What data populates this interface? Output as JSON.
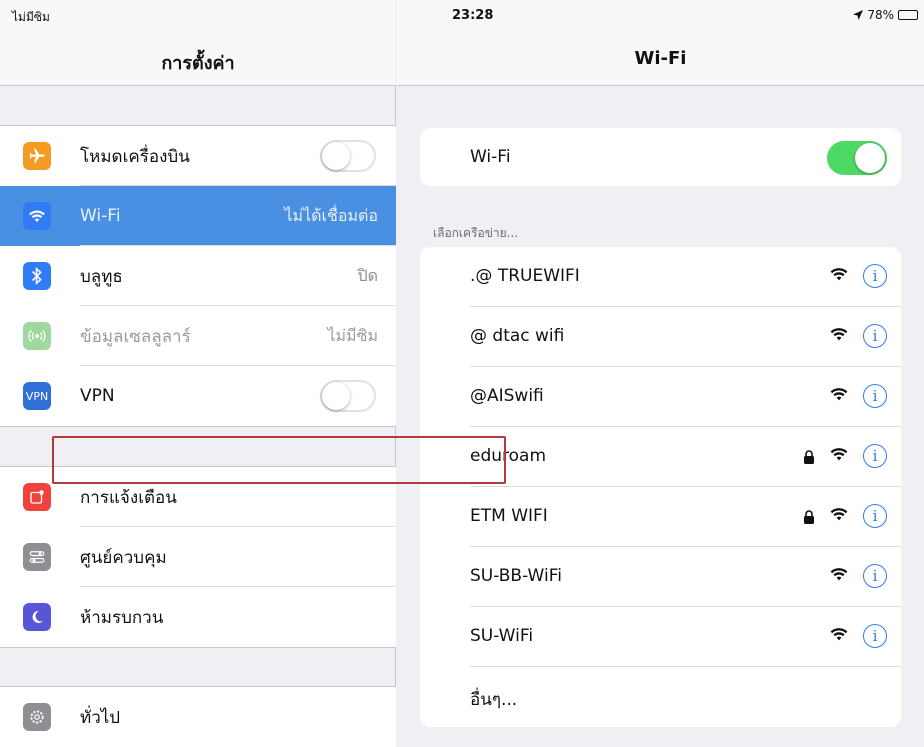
{
  "status": {
    "carrier": "ไม่มีซิม",
    "time": "23:28",
    "battery": "78%",
    "battery_level": 0.78
  },
  "left": {
    "title": "การตั้งค่า",
    "group1": [
      {
        "label": "โหมดเครื่องบิน",
        "icon": "airplane-icon",
        "color": "#f59a23",
        "toggle": false
      },
      {
        "label": "Wi-Fi",
        "icon": "wifi-icon",
        "color": "#2f7cf6",
        "value": "ไม่ได้เชื่อมต่อ",
        "selected": true
      },
      {
        "label": "บลูทูธ",
        "icon": "bluetooth-icon",
        "color": "#2f7cf6",
        "value": "ปิด"
      },
      {
        "label": "ข้อมูลเซลลูลาร์",
        "icon": "cellular-icon",
        "color": "#9fd89f",
        "value": "ไม่มีซิม",
        "dim": true
      },
      {
        "label": "VPN",
        "icon": "vpn-icon",
        "badge": "VPN",
        "color": "#2f6fd6",
        "toggle": false
      }
    ],
    "group2": [
      {
        "label": "การแจ้งเตือน",
        "icon": "notifications-icon",
        "color": "#f0413b"
      },
      {
        "label": "ศูนย์ควบคุม",
        "icon": "control-center-icon",
        "color": "#8e8e93"
      },
      {
        "label": "ห้ามรบกวน",
        "icon": "moon-icon",
        "color": "#5856d6"
      }
    ],
    "group3": [
      {
        "label": "ทั่วไป",
        "icon": "gear-icon",
        "color": "#8e8e93"
      }
    ]
  },
  "right": {
    "title": "Wi-Fi",
    "wifi_label": "Wi-Fi",
    "wifi_on": true,
    "section_label": "เลือกเครือข่าย...",
    "networks": [
      {
        "name": ".@  TRUEWIFI",
        "locked": false
      },
      {
        "name": "@ dtac wifi",
        "locked": false
      },
      {
        "name": "@AISwifi",
        "locked": false
      },
      {
        "name": "eduroam",
        "locked": true,
        "highlighted": true
      },
      {
        "name": "ETM WIFI",
        "locked": true
      },
      {
        "name": "SU-BB-WiFi",
        "locked": false
      },
      {
        "name": "SU-WiFi",
        "locked": false
      },
      {
        "name": "อื่นๆ...",
        "other": true
      }
    ]
  }
}
